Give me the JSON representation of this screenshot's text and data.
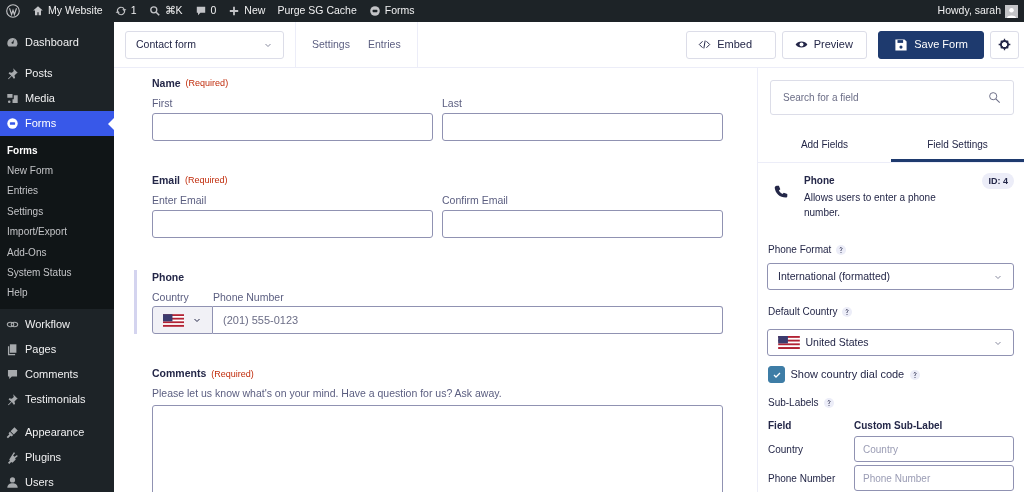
{
  "admin_bar": {
    "items": [
      {
        "label": "My Website"
      },
      {
        "label": "1"
      },
      {
        "label": "⌘K"
      },
      {
        "label": "0"
      },
      {
        "label": "New"
      },
      {
        "label": "Purge SG Cache"
      },
      {
        "label": "Forms"
      }
    ],
    "greeting": "Howdy, sarah"
  },
  "sidebar": {
    "items": [
      {
        "label": "Dashboard",
        "selected": false
      },
      {
        "label": "Posts",
        "selected": false
      },
      {
        "label": "Media",
        "selected": false
      },
      {
        "label": "Forms",
        "selected": true,
        "children": [
          {
            "label": "Forms",
            "selected": true
          },
          {
            "label": "New Form",
            "selected": false
          },
          {
            "label": "Entries",
            "selected": false
          },
          {
            "label": "Settings",
            "selected": false
          },
          {
            "label": "Import/Export",
            "selected": false
          },
          {
            "label": "Add-Ons",
            "selected": false
          },
          {
            "label": "System Status",
            "selected": false
          },
          {
            "label": "Help",
            "selected": false
          }
        ]
      },
      {
        "label": "Workflow",
        "selected": false
      },
      {
        "label": "Pages",
        "selected": false
      },
      {
        "label": "Comments",
        "selected": false
      },
      {
        "label": "Testimonials",
        "selected": false
      },
      {
        "label": "Appearance",
        "selected": false
      },
      {
        "label": "Plugins",
        "selected": false
      },
      {
        "label": "Users",
        "selected": false
      }
    ]
  },
  "toolbar": {
    "form_select": "Contact form",
    "links": [
      "Settings",
      "Entries"
    ],
    "buttons": [
      {
        "label": "Embed",
        "kind": "embed"
      },
      {
        "label": "Preview",
        "kind": "preview"
      },
      {
        "label": "Save Form",
        "kind": "save"
      }
    ]
  },
  "form": {
    "fields": [
      {
        "kind": "pair",
        "label": "Name",
        "required": "(Required)",
        "selected": false,
        "sublabels": [
          "First",
          "Last"
        ]
      },
      {
        "kind": "pair",
        "label": "Email",
        "required": "(Required)",
        "selected": false,
        "sublabels": [
          "Enter Email",
          "Confirm Email"
        ]
      },
      {
        "kind": "phone",
        "label": "Phone",
        "selected": true,
        "sublabels": [
          "Country",
          "Phone Number"
        ],
        "placeholder": "(201) 555-0123"
      },
      {
        "kind": "textarea",
        "label": "Comments",
        "required": "(Required)",
        "selected": false,
        "description": "Please let us know what's on your mind. Have a question for us? Ask away."
      }
    ]
  },
  "panel": {
    "search": {
      "placeholder": "Search for a field"
    },
    "tabs": [
      {
        "label": "Add Fields",
        "selected": false
      },
      {
        "label": "Field Settings",
        "selected": true
      }
    ],
    "field": {
      "title": "Phone",
      "description": "Allows users to enter a phone number.",
      "id": "ID: 4"
    },
    "phone_format": {
      "label": "Phone Format",
      "value": "International (formatted)"
    },
    "default_country": {
      "label": "Default Country",
      "value": "United States"
    },
    "dial_code": {
      "label": "Show country dial code",
      "checked": true
    },
    "sub_labels": {
      "label": "Sub-Labels",
      "columns": [
        "Field",
        "Custom Sub-Label"
      ],
      "rows": [
        {
          "field": "Country",
          "placeholder": "Country"
        },
        {
          "field": "Phone Number",
          "placeholder": "Phone Number"
        }
      ]
    }
  }
}
